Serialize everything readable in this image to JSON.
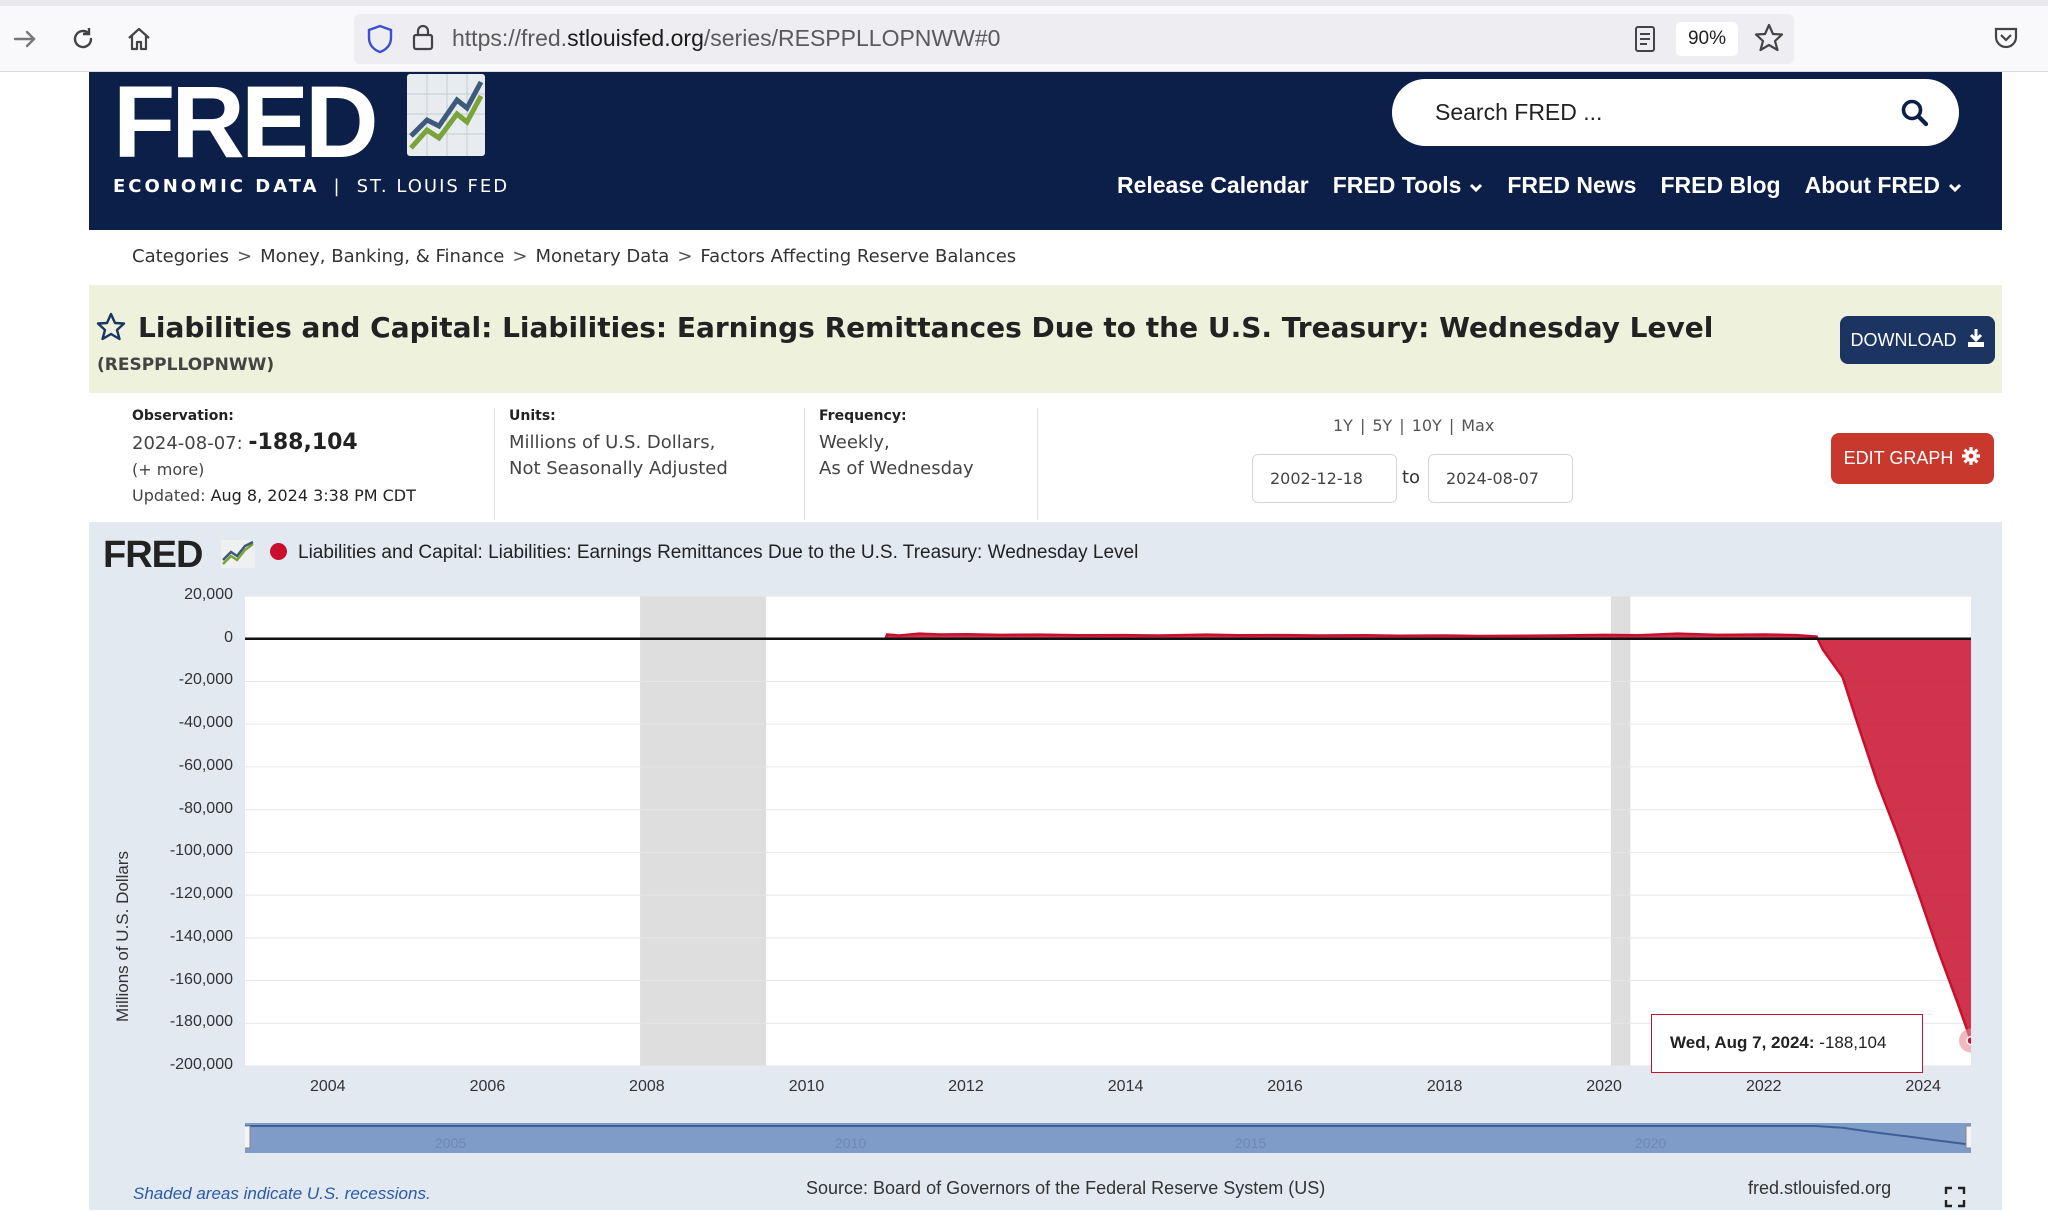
{
  "browser": {
    "url_prefix": "https://fred.",
    "url_host": "stlouisfed.org",
    "url_path": "/series/RESPPLLOPNWW#0",
    "zoom": "90%"
  },
  "header": {
    "logo": "FRED",
    "logo_sub_left": "ECONOMIC DATA",
    "logo_sub_sep": "|",
    "logo_sub_right": "ST. LOUIS FED",
    "search_placeholder": "Search FRED ...",
    "nav": [
      {
        "label": "Release Calendar"
      },
      {
        "label": "FRED Tools"
      },
      {
        "label": "FRED News"
      },
      {
        "label": "FRED Blog"
      },
      {
        "label": "About FRED"
      }
    ]
  },
  "breadcrumb": [
    "Categories",
    "Money, Banking, & Finance",
    "Monetary Data",
    "Factors Affecting Reserve Balances"
  ],
  "breadcrumb_sep": ">",
  "series": {
    "title": "Liabilities and Capital: Liabilities: Earnings Remittances Due to the U.S. Treasury: Wednesday Level",
    "id": "(RESPPLLOPNWW)",
    "download_label": "DOWNLOAD"
  },
  "meta": {
    "observation_label": "Observation:",
    "observation_date": "2024-08-07:",
    "observation_value": "-188,104",
    "more": "(+ more)",
    "updated_label": "Updated:",
    "updated_value": "Aug 8, 2024 3:38 PM CDT",
    "units_label": "Units:",
    "units_line1": "Millions of U.S. Dollars,",
    "units_line2": "Not Seasonally Adjusted",
    "frequency_label": "Frequency:",
    "frequency_line1": "Weekly,",
    "frequency_line2": "As of Wednesday"
  },
  "range": {
    "links": [
      "1Y",
      "5Y",
      "10Y",
      "Max"
    ],
    "sep": "|",
    "from": "2002-12-18",
    "to_label": "to",
    "to": "2024-08-07",
    "edit_label": "EDIT GRAPH"
  },
  "graph": {
    "mini_logo": "FRED",
    "legend": "Liabilities and Capital: Liabilities: Earnings Remittances Due to the U.S. Treasury: Wednesday Level",
    "y_axis_title": "Millions of U.S. Dollars",
    "tooltip_date": "Wed, Aug 7, 2024:",
    "tooltip_value": "-188,104",
    "recession_note": "Shaded areas indicate U.S. recessions.",
    "source": "Source: Board of Governors of the Federal Reserve System (US)",
    "site": "fred.stlouisfed.org",
    "navigator_labels": [
      "2005",
      "2010",
      "2015",
      "2020"
    ]
  },
  "colors": {
    "header_bg": "#0c1f48",
    "series": "#c8102e",
    "recession": "#dedede",
    "download_bg": "#1c3461",
    "edit_bg": "#c8382c"
  },
  "chart_data": {
    "type": "area",
    "x_range": [
      "2002-12-18",
      "2024-08-07"
    ],
    "ylim": [
      -200000,
      20000
    ],
    "y_ticks": [
      20000,
      0,
      -20000,
      -40000,
      -60000,
      -80000,
      -100000,
      -120000,
      -140000,
      -160000,
      -180000,
      -200000
    ],
    "y_tick_labels": [
      "20,000",
      "0",
      "-20,000",
      "-40,000",
      "-60,000",
      "-80,000",
      "-100,000",
      "-120,000",
      "-140,000",
      "-160,000",
      "-180,000",
      "-200,000"
    ],
    "x_ticks": [
      "2004",
      "2006",
      "2008",
      "2010",
      "2012",
      "2014",
      "2016",
      "2018",
      "2020",
      "2022",
      "2024"
    ],
    "ylabel": "Millions of U.S. Dollars",
    "recessions": [
      [
        "2007-12-01",
        "2009-06-30"
      ],
      [
        "2020-02-01",
        "2020-04-30"
      ]
    ],
    "series": [
      {
        "name": "Liabilities and Capital: Liabilities: Earnings Remittances Due to the U.S. Treasury: Wednesday Level",
        "x": [
          "2002-12-18",
          "2010-12-29",
          "2011-01-05",
          "2011-03-02",
          "2011-06-01",
          "2011-09-07",
          "2012-01-04",
          "2012-06-06",
          "2012-12-05",
          "2013-06-05",
          "2014-01-01",
          "2014-06-04",
          "2015-01-07",
          "2015-06-03",
          "2016-01-06",
          "2016-06-01",
          "2017-01-04",
          "2017-06-07",
          "2018-01-03",
          "2018-06-06",
          "2019-01-02",
          "2019-06-05",
          "2020-01-01",
          "2020-06-03",
          "2020-12-02",
          "2021-06-02",
          "2022-01-05",
          "2022-06-01",
          "2022-08-31",
          "2022-09-28",
          "2022-12-28",
          "2023-03-01",
          "2023-06-07",
          "2023-09-06",
          "2023-12-06",
          "2024-03-06",
          "2024-06-05",
          "2024-08-07"
        ],
        "values": [
          0,
          0,
          2000,
          1500,
          2400,
          2000,
          2100,
          1800,
          1900,
          1600,
          1700,
          1500,
          1900,
          1600,
          1700,
          1500,
          1600,
          1400,
          1500,
          1300,
          1400,
          1500,
          1800,
          1600,
          2400,
          1800,
          2000,
          1700,
          1000,
          -5000,
          -18000,
          -38000,
          -68000,
          -92000,
          -118000,
          -145000,
          -170000,
          -188104
        ]
      }
    ]
  }
}
